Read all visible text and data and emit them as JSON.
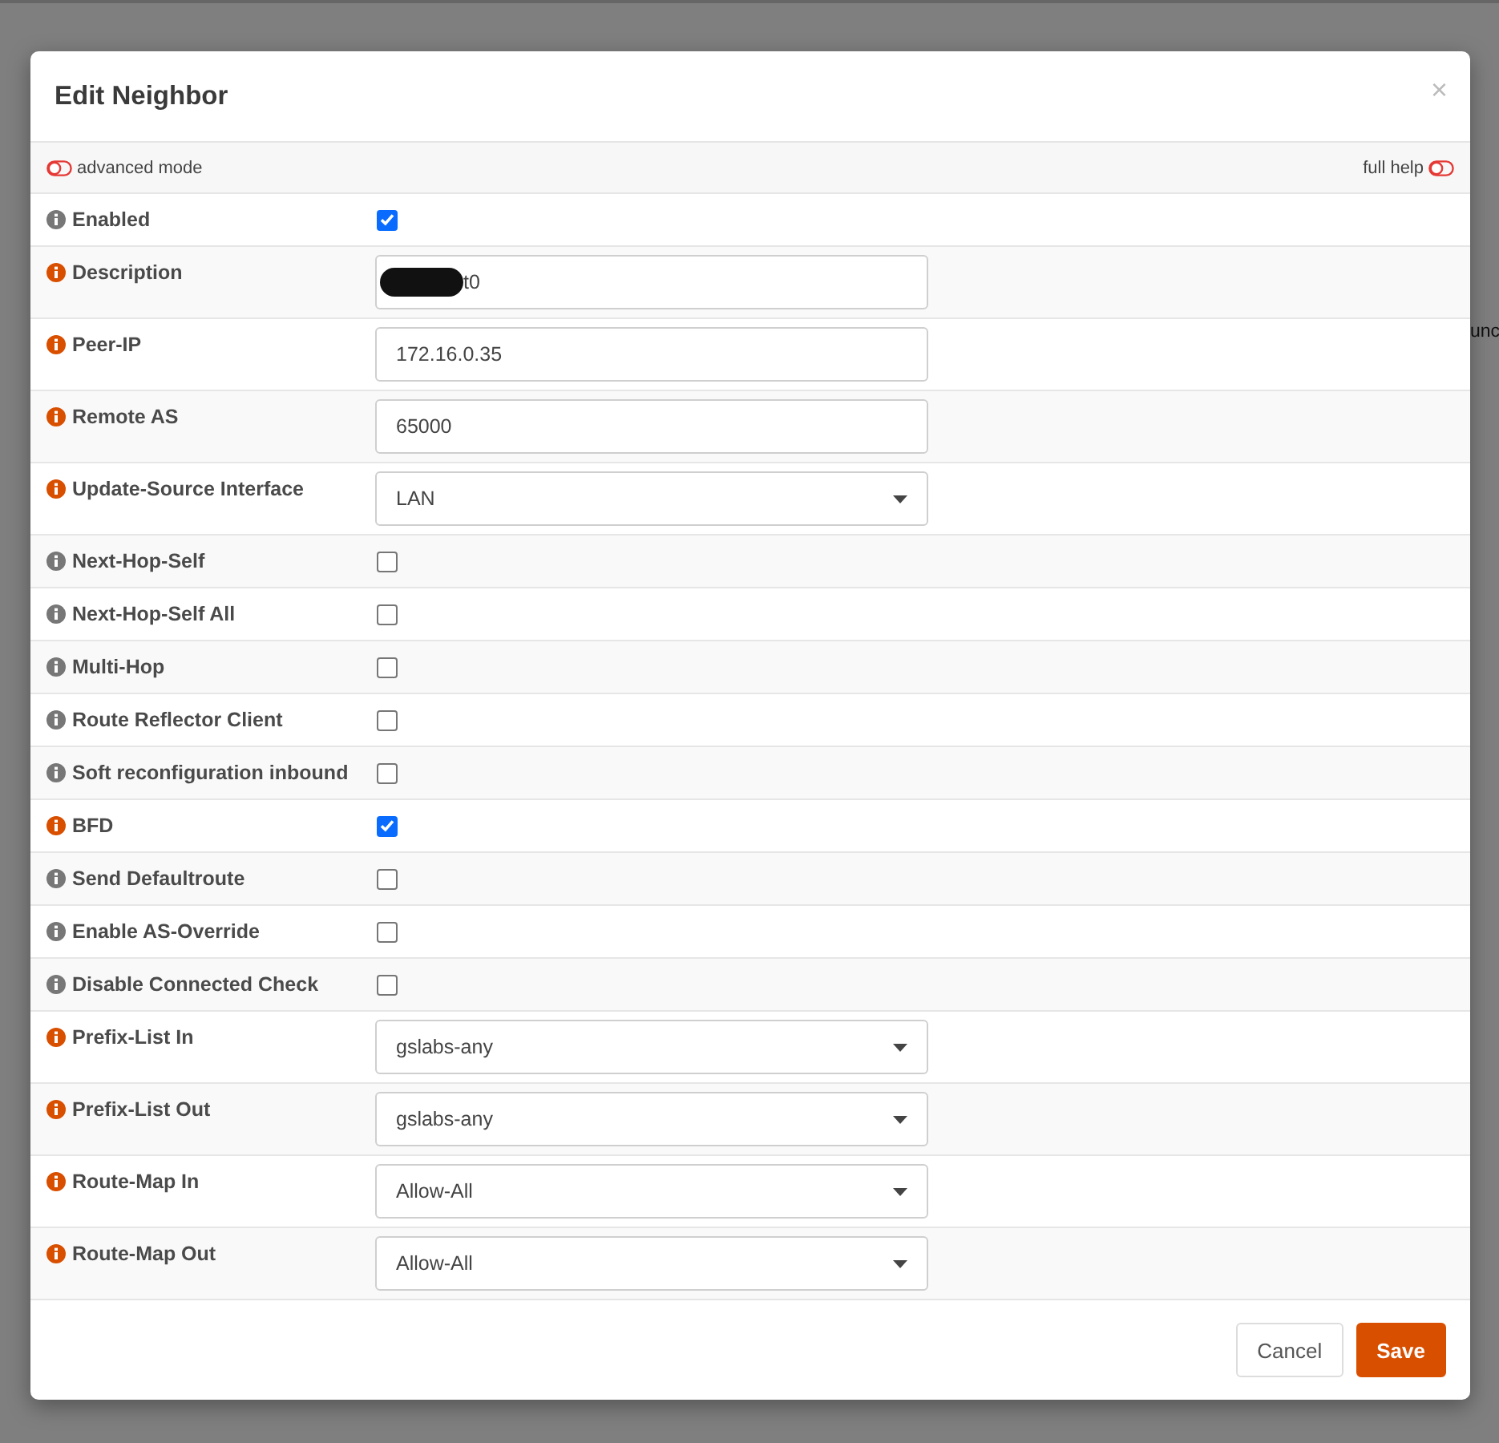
{
  "background": {
    "text_fragment": "unc"
  },
  "dialog": {
    "title": "Edit Neighbor",
    "close": "×"
  },
  "toolbar": {
    "advanced_mode": {
      "label": "advanced mode",
      "on": false
    },
    "full_help": {
      "label": "full help",
      "on": false
    }
  },
  "fields": [
    {
      "label": "Enabled",
      "kind": "checkbox",
      "checked": true,
      "color": "#777777"
    },
    {
      "label": "Description",
      "kind": "text",
      "value": "t0",
      "redacted": true,
      "color": "#d94f00"
    },
    {
      "label": "Peer-IP",
      "kind": "text",
      "value": "172.16.0.35",
      "color": "#d94f00"
    },
    {
      "label": "Remote AS",
      "kind": "text",
      "value": "65000",
      "color": "#d94f00"
    },
    {
      "label": "Update-Source Interface",
      "kind": "select",
      "value": "LAN",
      "color": "#d94f00"
    },
    {
      "label": "Next-Hop-Self",
      "kind": "checkbox",
      "checked": false,
      "color": "#777777"
    },
    {
      "label": "Next-Hop-Self All",
      "kind": "checkbox",
      "checked": false,
      "color": "#777777"
    },
    {
      "label": "Multi-Hop",
      "kind": "checkbox",
      "checked": false,
      "color": "#777777"
    },
    {
      "label": "Route Reflector Client",
      "kind": "checkbox",
      "checked": false,
      "color": "#777777"
    },
    {
      "label": "Soft reconfiguration inbound",
      "kind": "checkbox",
      "checked": false,
      "color": "#777777"
    },
    {
      "label": "BFD",
      "kind": "checkbox",
      "checked": true,
      "color": "#d94f00"
    },
    {
      "label": "Send Defaultroute",
      "kind": "checkbox",
      "checked": false,
      "color": "#777777"
    },
    {
      "label": "Enable AS-Override",
      "kind": "checkbox",
      "checked": false,
      "color": "#777777"
    },
    {
      "label": "Disable Connected Check",
      "kind": "checkbox",
      "checked": false,
      "color": "#777777"
    },
    {
      "label": "Prefix-List In",
      "kind": "select",
      "value": "gslabs-any",
      "color": "#d94f00"
    },
    {
      "label": "Prefix-List Out",
      "kind": "select",
      "value": "gslabs-any",
      "color": "#d94f00"
    },
    {
      "label": "Route-Map In",
      "kind": "select",
      "value": "Allow-All",
      "color": "#d94f00"
    },
    {
      "label": "Route-Map Out",
      "kind": "select",
      "value": "Allow-All",
      "color": "#d94f00"
    }
  ],
  "buttons": [
    {
      "label": "Cancel",
      "kind": "secondary"
    },
    {
      "label": "Save",
      "kind": "primary"
    }
  ]
}
